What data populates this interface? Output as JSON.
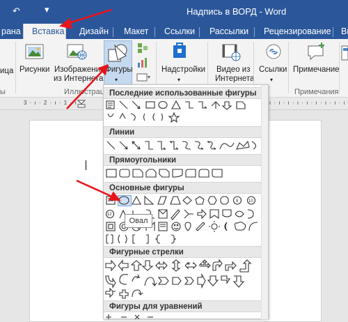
{
  "window": {
    "title": "Надпись в ВОРД - Word",
    "quick_access_icon": "save-icon",
    "customize_icon": "chevron-down-icon"
  },
  "tabs": [
    {
      "label": "рана"
    },
    {
      "label": "Вставка"
    },
    {
      "label": "Дизайн"
    },
    {
      "label": "Макет"
    },
    {
      "label": "Ссылки"
    },
    {
      "label": "Рассылки"
    },
    {
      "label": "Рецензирование"
    },
    {
      "label": "Вид"
    }
  ],
  "ribbon": {
    "partial_left_label": "ица",
    "pictures_label": "Рисунки",
    "online_pictures_line1": "Изображения",
    "online_pictures_line2": "из Интернета",
    "shapes_label": "Фигуры",
    "addins_label": "Надстройки",
    "video_line1": "Видео из",
    "video_line2": "Интернета",
    "links_label": "Ссылки",
    "comment_label": "Примечание",
    "group_illustrations": "Иллюстрации",
    "group_comments": "Примечания"
  },
  "gallery": {
    "sections": [
      {
        "title": "Последние использованные фигуры"
      },
      {
        "title": "Линии"
      },
      {
        "title": "Прямоугольники"
      },
      {
        "title": "Основные фигуры"
      },
      {
        "title": "Фигурные стрелки"
      },
      {
        "title": "Фигуры для уравнений"
      }
    ],
    "tooltip": "Овал"
  },
  "colors": {
    "accent": "#2b579a",
    "annotation_arrow": "#e8141c",
    "hover": "#cfe0f4"
  }
}
